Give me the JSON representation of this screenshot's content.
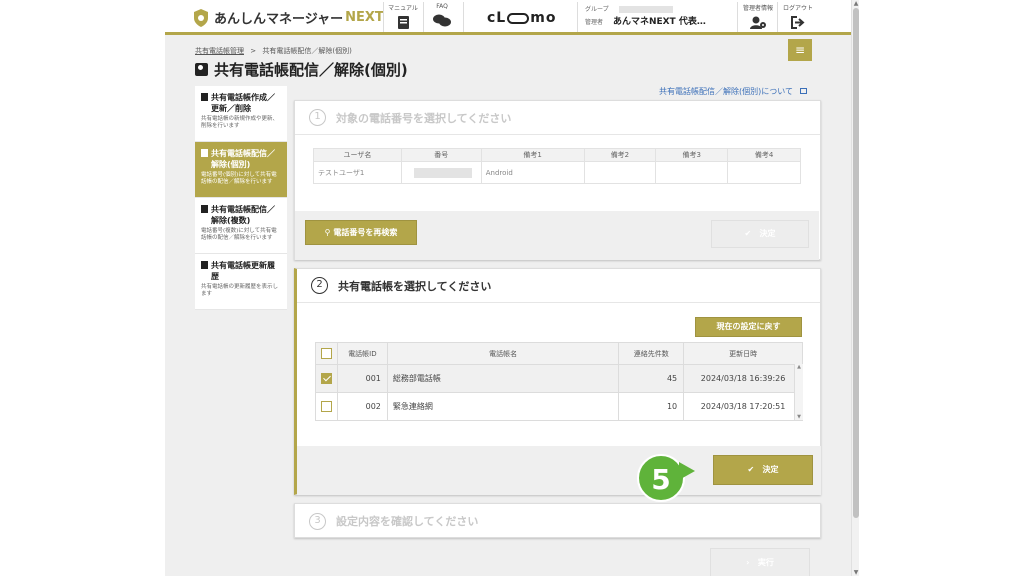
{
  "header": {
    "app_name": "あんしんマネージャー",
    "app_suffix": "NEXT",
    "manual": "マニュアル",
    "faq": "FAQ",
    "brand": "CLOMO",
    "group_label": "グループ",
    "admin_label": "管理者",
    "admin_value": "あんマネNEXT 代表…",
    "admin_info": "管理者情報",
    "logout": "ログアウト"
  },
  "breadcrumb": {
    "root": "共有電話帳管理",
    "sep": ">",
    "current": "共有電話帳配信／解除(個別)"
  },
  "page_title": "共有電話帳配信／解除(個別)",
  "help_link": "共有電話帳配信／解除(個別)について",
  "sidebar": {
    "items": [
      {
        "title": "共有電話帳作成／更新／削除",
        "desc": "共有電話帳の新規作成や更新、削除を行います"
      },
      {
        "title": "共有電話帳配信／解除(個別)",
        "desc": "電話番号(個別)に対して共有電話帳の配信／解除を行います"
      },
      {
        "title": "共有電話帳配信／解除(複数)",
        "desc": "電話番号(複数)に対して共有電話帳の配信／解除を行います"
      },
      {
        "title": "共有電話帳更新履歴",
        "desc": "共有電話帳の更新履歴を表示します"
      }
    ]
  },
  "step1": {
    "num": "1",
    "title": "対象の電話番号を選択してください",
    "headers": [
      "ユーザ名",
      "番号",
      "備考1",
      "備考2",
      "備考3",
      "備考4"
    ],
    "row": {
      "user": "テストユーザ1",
      "note1": "Android"
    },
    "research_btn": "電話番号を再検索",
    "decide_btn": "決定"
  },
  "step2": {
    "num": "2",
    "title": "共有電話帳を選択してください",
    "reset_btn": "現在の設定に戻す",
    "headers": [
      "電話帳ID",
      "電話帳名",
      "連絡先件数",
      "更新日時"
    ],
    "rows": [
      {
        "checked": true,
        "id": "001",
        "name": "総務部電話帳",
        "count": "45",
        "updated": "2024/03/18 16:39:26"
      },
      {
        "checked": false,
        "id": "002",
        "name": "緊急連絡網",
        "count": "10",
        "updated": "2024/03/18 17:20:51"
      }
    ],
    "decide_btn": "決定"
  },
  "callout": "5",
  "step3": {
    "num": "3",
    "title": "設定内容を確認してください",
    "run_btn": "実行"
  },
  "colors": {
    "accent": "#b3a64a",
    "callout": "#5fb33a",
    "link": "#3b6fb8"
  }
}
